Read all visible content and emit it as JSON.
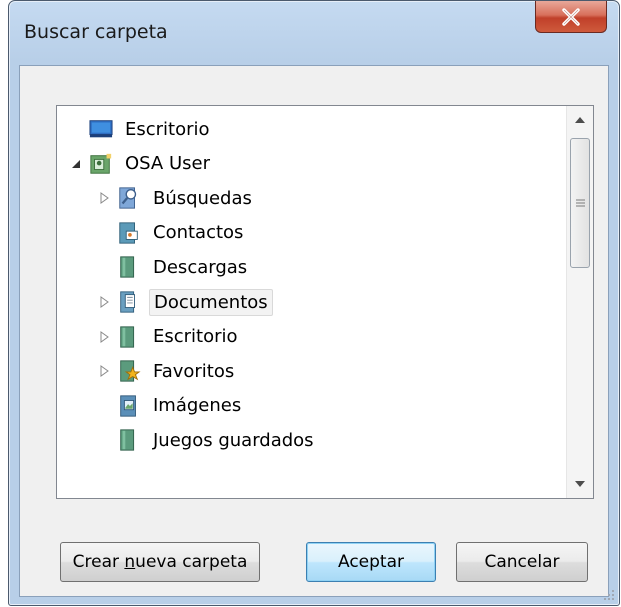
{
  "window": {
    "title": "Buscar carpeta"
  },
  "tree": {
    "items": [
      {
        "label": "Escritorio",
        "icon": "desktop-icon",
        "expander": "none"
      },
      {
        "label": "OSA User",
        "icon": "user-folder-icon",
        "expander": "expanded"
      },
      {
        "label": "Búsquedas",
        "icon": "searches-folder-icon",
        "expander": "collapsed"
      },
      {
        "label": "Contactos",
        "icon": "contacts-folder-icon",
        "expander": "none"
      },
      {
        "label": "Descargas",
        "icon": "downloads-folder-icon",
        "expander": "none"
      },
      {
        "label": "Documentos",
        "icon": "documents-folder-icon",
        "expander": "collapsed",
        "selected": true
      },
      {
        "label": "Escritorio",
        "icon": "desktop-folder-icon",
        "expander": "collapsed"
      },
      {
        "label": "Favoritos",
        "icon": "favorites-folder-icon",
        "expander": "collapsed"
      },
      {
        "label": "Imágenes",
        "icon": "pictures-folder-icon",
        "expander": "none"
      },
      {
        "label": "Juegos guardados",
        "icon": "saved-games-folder-icon",
        "expander": "none"
      }
    ]
  },
  "buttons": {
    "new_folder_prefix": "Crear ",
    "new_folder_mnemonic": "n",
    "new_folder_suffix": "ueva carpeta",
    "ok": "Aceptar",
    "cancel": "Cancelar"
  },
  "colors": {
    "titlebar": "#c5daf1",
    "close": "#c0402a",
    "selection": "#f3f3f3",
    "default_button_border": "#3c7fb1"
  }
}
